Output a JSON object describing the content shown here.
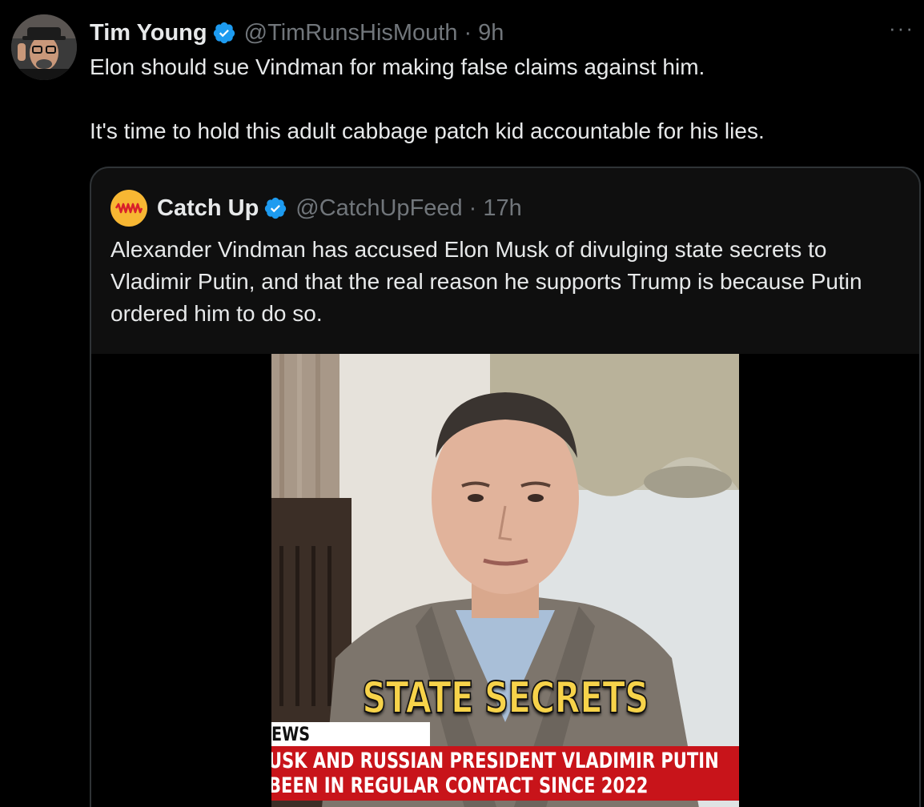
{
  "tweet": {
    "author_name": "Tim Young",
    "author_handle": "@TimRunsHisMouth",
    "separator": "·",
    "time": "9h",
    "more_label": "···",
    "text_line1": "Elon should sue Vindman for making false claims against him.",
    "text_line2": "It's time to hold this adult cabbage patch kid accountable for his lies."
  },
  "quoted": {
    "author_name": "Catch Up",
    "author_handle": "@CatchUpFeed",
    "separator": "·",
    "time": "17h",
    "text": "Alexander Vindman has accused Elon Musk of divulging state secrets to Vladimir Putin, and that the real reason he supports Trump is because Putin ordered him to do so."
  },
  "video": {
    "caption": "STATE SECRETS",
    "network_fragment": "EWS",
    "ticker_line1": "USK AND RUSSIAN PRESIDENT VLADIMIR PUTIN",
    "ticker_line2": "BEEN IN REGULAR CONTACT SINCE 2022"
  },
  "colors": {
    "verified_badge": "#1d9bf0",
    "muted_text": "#71767b",
    "caption_yellow": "#f7d34a",
    "ticker_red": "#c8141a"
  },
  "icons": {
    "verified": "verified-badge-icon",
    "more": "more-options-icon",
    "catchup_logo": "catchup-logo-icon"
  }
}
